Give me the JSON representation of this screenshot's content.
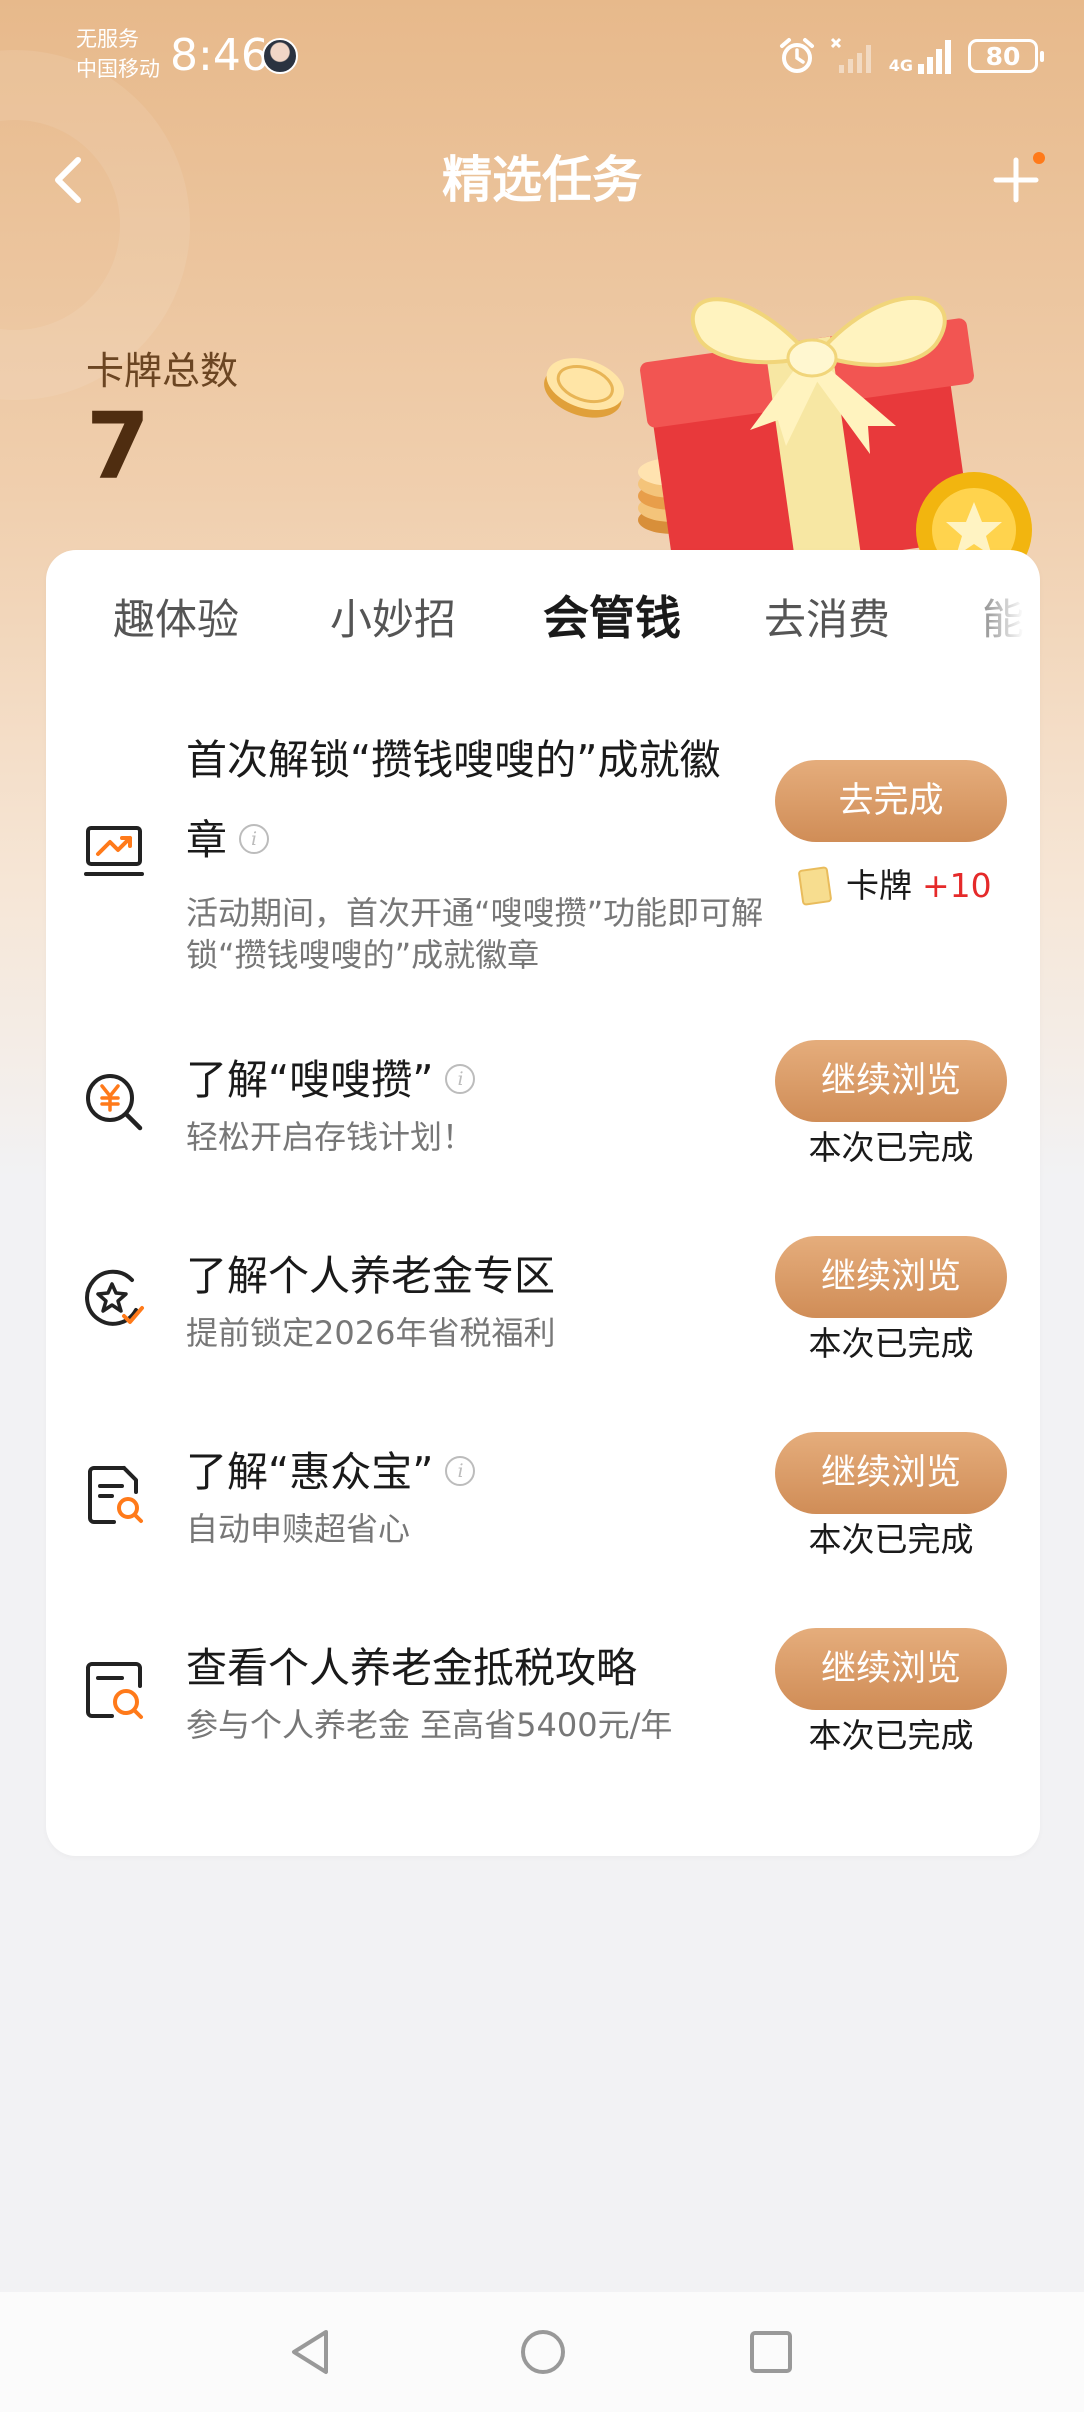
{
  "status_bar": {
    "carrier_line1": "无服务",
    "carrier_line2": "中国移动",
    "time": "8:46",
    "network": "4G",
    "battery": "80"
  },
  "nav": {
    "title": "精选任务"
  },
  "summary": {
    "label": "卡牌总数",
    "value": "7"
  },
  "tabs": [
    {
      "label": "趣体验",
      "active": false
    },
    {
      "label": "小妙招",
      "active": false
    },
    {
      "label": "会管钱",
      "active": true
    },
    {
      "label": "去消费",
      "active": false
    },
    {
      "label": "能力",
      "active": false
    }
  ],
  "tasks": [
    {
      "title_line1": "首次解锁“攒钱嗖嗖的”成就徽",
      "title_line2": "章",
      "desc": "活动期间，首次开通“嗖嗖攒”功能即可解锁“攒钱嗖嗖的”成就徽章",
      "button": "去完成",
      "reward_label": "卡牌",
      "reward_points": "+10",
      "icon": "chart-trend-icon"
    },
    {
      "title": "了解“嗖嗖攒”",
      "desc": "轻松开启存钱计划！",
      "button": "继续浏览",
      "status": "本次已完成",
      "icon": "yuan-search-icon"
    },
    {
      "title": "了解个人养老金专区",
      "desc": "提前锁定2026年省税福利",
      "button": "继续浏览",
      "status": "本次已完成",
      "icon": "star-check-icon"
    },
    {
      "title": "了解“惠众宝”",
      "desc": "自动申赎超省心",
      "button": "继续浏览",
      "status": "本次已完成",
      "icon": "document-search-icon"
    },
    {
      "title": "查看个人养老金抵税攻略",
      "desc": "参与个人养老金 至高省5400元/年",
      "button": "继续浏览",
      "status": "本次已完成",
      "icon": "folder-search-icon"
    }
  ],
  "colors": {
    "accent_orange": "#ff7a1a",
    "button_gradient_top": "#e5ad7c",
    "button_gradient_bottom": "#d08d57",
    "reward_red": "#e52a2a"
  }
}
